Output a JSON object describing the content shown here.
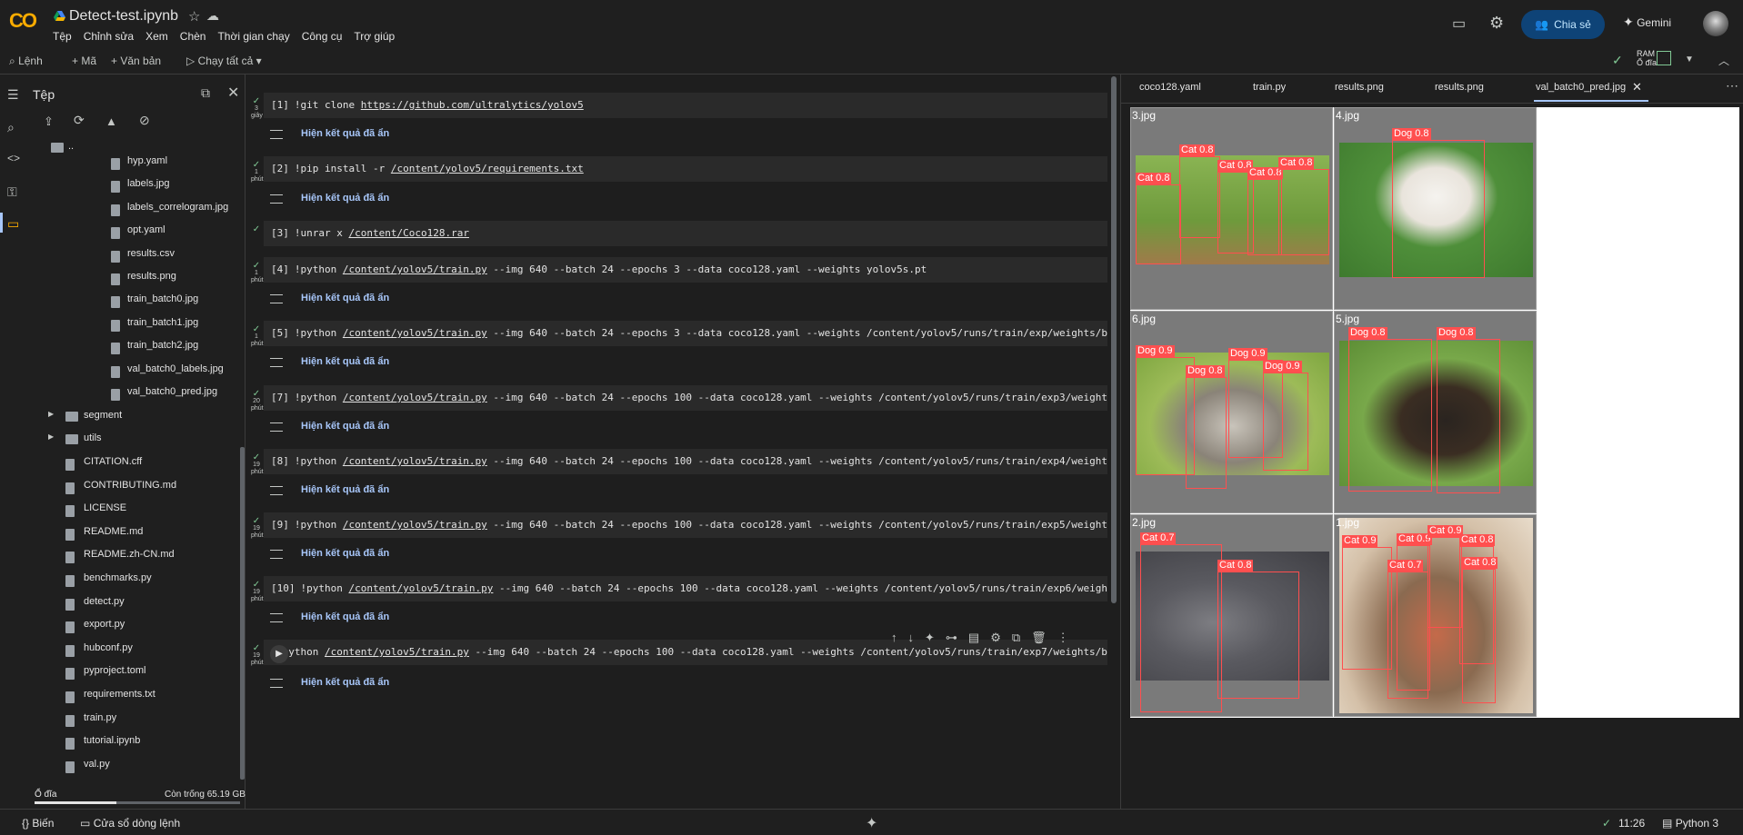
{
  "header": {
    "logo": "CO",
    "title": "Detect-test.ipynb",
    "menu": [
      "Tệp",
      "Chỉnh sửa",
      "Xem",
      "Chèn",
      "Thời gian chạy",
      "Công cụ",
      "Trợ giúp"
    ],
    "share": "Chia sẻ",
    "gemini": "Gemini"
  },
  "toolbar": {
    "command": "Lệnh",
    "code": "+ Mã",
    "text": "+ Văn bản",
    "run_all": "Chạy tất cả",
    "ram": "RAM",
    "disk": "Ổ đĩa"
  },
  "files": {
    "title": "Tệp",
    "parent": "..",
    "items": [
      "hyp.yaml",
      "labels.jpg",
      "labels_correlogram.jpg",
      "opt.yaml",
      "results.csv",
      "results.png",
      "train_batch0.jpg",
      "train_batch1.jpg",
      "train_batch2.jpg",
      "val_batch0_labels.jpg",
      "val_batch0_pred.jpg"
    ],
    "folders": [
      "segment",
      "utils"
    ],
    "root_files": [
      "CITATION.cff",
      "CONTRIBUTING.md",
      "LICENSE",
      "README.md",
      "README.zh-CN.md",
      "benchmarks.py",
      "detect.py",
      "export.py",
      "hubconf.py",
      "pyproject.toml",
      "requirements.txt",
      "train.py",
      "tutorial.ipynb",
      "val.py"
    ],
    "disk_label": "Ổ đĩa",
    "free_label": "Còn trống 65.19 GB"
  },
  "cells": [
    {
      "num": "[1]",
      "pre": "!git clone ",
      "link": "https://github.com/ultralytics/yolov5",
      "post": "",
      "time": "3 giây",
      "out": "Hiện kết quả đã ẩn"
    },
    {
      "num": "[2]",
      "pre": "!pip install -r ",
      "link": "/content/yolov5/requirements.txt",
      "post": "",
      "time": "1 phút",
      "out": "Hiện kết quả đã ẩn"
    },
    {
      "num": "[3]",
      "pre": "!unrar x ",
      "link": "/content/Coco128.rar",
      "post": "",
      "time": "",
      "out": ""
    },
    {
      "num": "[4]",
      "pre": "!python ",
      "link": "/content/yolov5/train.py",
      "post": " --img 640 --batch 24 --epochs 3 --data coco128.yaml --weights yolov5s.pt",
      "time": "1 phút",
      "out": "Hiện kết quả đã ẩn"
    },
    {
      "num": "[5]",
      "pre": "!python ",
      "link": "/content/yolov5/train.py",
      "post": " --img 640 --batch 24 --epochs 3 --data coco128.yaml --weights /content/yolov5/runs/train/exp/weights/best.pt",
      "time": "1 phút",
      "out": "Hiện kết quả đã ẩn"
    },
    {
      "num": "[7]",
      "pre": "!python ",
      "link": "/content/yolov5/train.py",
      "post": " --img 640 --batch 24 --epochs 100 --data coco128.yaml --weights /content/yolov5/runs/train/exp3/weights/best.pt",
      "time": "20 phút",
      "out": "Hiện kết quả đã ẩn"
    },
    {
      "num": "[8]",
      "pre": "!python ",
      "link": "/content/yolov5/train.py",
      "post": " --img 640 --batch 24 --epochs 100 --data coco128.yaml --weights /content/yolov5/runs/train/exp4/weights/best.pt",
      "time": "19 phút",
      "out": "Hiện kết quả đã ẩn"
    },
    {
      "num": "[9]",
      "pre": "!python ",
      "link": "/content/yolov5/train.py",
      "post": " --img 640 --batch 24 --epochs 100 --data coco128.yaml --weights /content/yolov5/runs/train/exp5/weights/best.pt",
      "time": "19 phút",
      "out": "Hiện kết quả đã ẩn"
    },
    {
      "num": "[10]",
      "pre": "!python ",
      "link": "/content/yolov5/train.py",
      "post": " --img 640 --batch 24 --epochs 100 --data coco128.yaml --weights /content/yolov5/runs/train/exp6/weights/best.pt",
      "time": "19 phút",
      "out": "Hiện kết quả đã ẩn"
    },
    {
      "num": "",
      "pre": "!python ",
      "link": "/content/yolov5/train.py",
      "post": " --img 640 --batch 24 --epochs 100 --data coco128.yaml --weights /content/yolov5/runs/train/exp7/weights/best.pt",
      "time": "19 phút",
      "out": "Hiện kết quả đã ẩn"
    }
  ],
  "tabs": [
    "coco128.yaml",
    "train.py",
    "results.png",
    "results.png",
    "val_batch0_pred.jpg"
  ],
  "images": [
    {
      "name": "3.jpg",
      "tags": [
        "Cat 0.8",
        "Cat 0.8",
        "Cat 0.8",
        "Cat 0.8",
        "Cat 0.8"
      ]
    },
    {
      "name": "4.jpg",
      "tags": [
        "Dog 0.8"
      ]
    },
    {
      "name": "6.jpg",
      "tags": [
        "Dog 0.9",
        "Dog 0.8",
        "Dog 0.9",
        "Dog 0.9"
      ]
    },
    {
      "name": "5.jpg",
      "tags": [
        "Dog 0.8",
        "Dog 0.8"
      ]
    },
    {
      "name": "2.jpg",
      "tags": [
        "Cat 0.7",
        "Cat 0.8"
      ]
    },
    {
      "name": "1.jpg",
      "tags": [
        "Cat 0.9",
        "Cat 0.9",
        "Cat 0.9",
        "Cat 0.8",
        "Cat 0.7",
        "Cat 0.8"
      ]
    }
  ],
  "status": {
    "variables": "Biến",
    "terminal": "Cửa sổ dòng lệnh",
    "time": "11:26",
    "runtime": "Python 3"
  }
}
